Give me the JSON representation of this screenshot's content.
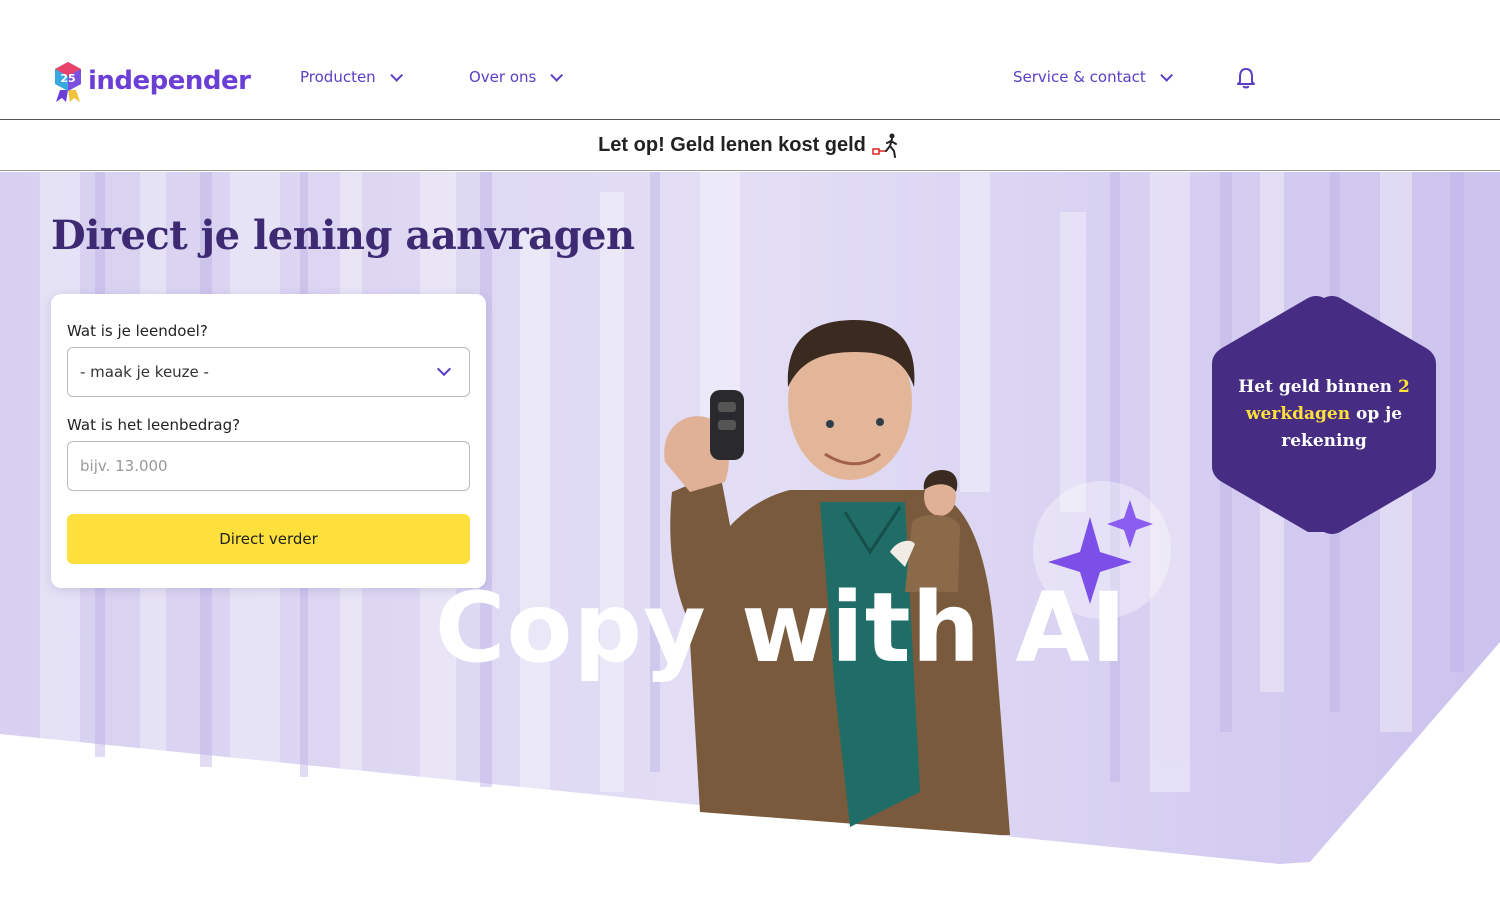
{
  "header": {
    "logo_text": "independer",
    "logo_badge": "25",
    "nav": [
      {
        "label": "Producten"
      },
      {
        "label": "Over ons"
      },
      {
        "label": "Service & contact"
      }
    ]
  },
  "notice": {
    "text": "Let op! Geld lenen kost geld"
  },
  "hero": {
    "title": "Direct je lening aanvragen",
    "form": {
      "purpose_label": "Wat is je leendoel?",
      "purpose_value": "- maak je keuze -",
      "amount_label": "Wat is het leenbedrag?",
      "amount_placeholder": "bijv. 13.000",
      "submit_label": "Direct verder"
    },
    "badge": {
      "line_a": "Het geld binnen ",
      "hl_a": "2",
      "hl_b": "werkdagen",
      "line_b": " op je",
      "line_c": "rekening"
    }
  },
  "watermark": "Copy with AI",
  "colors": {
    "brand_purple": "#5a3ec8",
    "dark_purple": "#3d2a72",
    "accent_yellow": "#fde03b",
    "hero_bg": "#d9d3f2"
  },
  "icons": [
    "chevron-down-icon",
    "bell-icon",
    "logo-badge-icon",
    "walking-person-icon",
    "sparkle-icon"
  ]
}
